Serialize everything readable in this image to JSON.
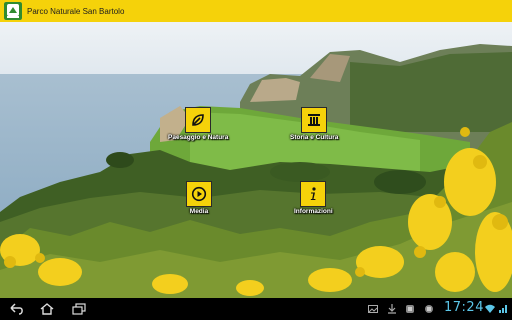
{
  "app": {
    "title": "Parco Naturale San Bartolo",
    "icon": "park-logo-icon"
  },
  "menu": [
    {
      "label": "Paesaggio e Natura",
      "icon": "leaf-icon"
    },
    {
      "label": "Storia e Cultura",
      "icon": "column-icon"
    },
    {
      "label": "Media",
      "icon": "play-icon"
    },
    {
      "label": "Informazioni",
      "icon": "info-icon"
    }
  ],
  "colors": {
    "accent": "#f5d20a",
    "clock": "#5cc6e8"
  },
  "system_bar": {
    "buttons": [
      "back-icon",
      "home-icon",
      "recent-apps-icon"
    ],
    "status_icons": [
      "gallery-icon",
      "download-icon",
      "app-icon",
      "app-icon-2",
      "wifi-icon",
      "signal-icon"
    ],
    "clock": "17:24"
  }
}
